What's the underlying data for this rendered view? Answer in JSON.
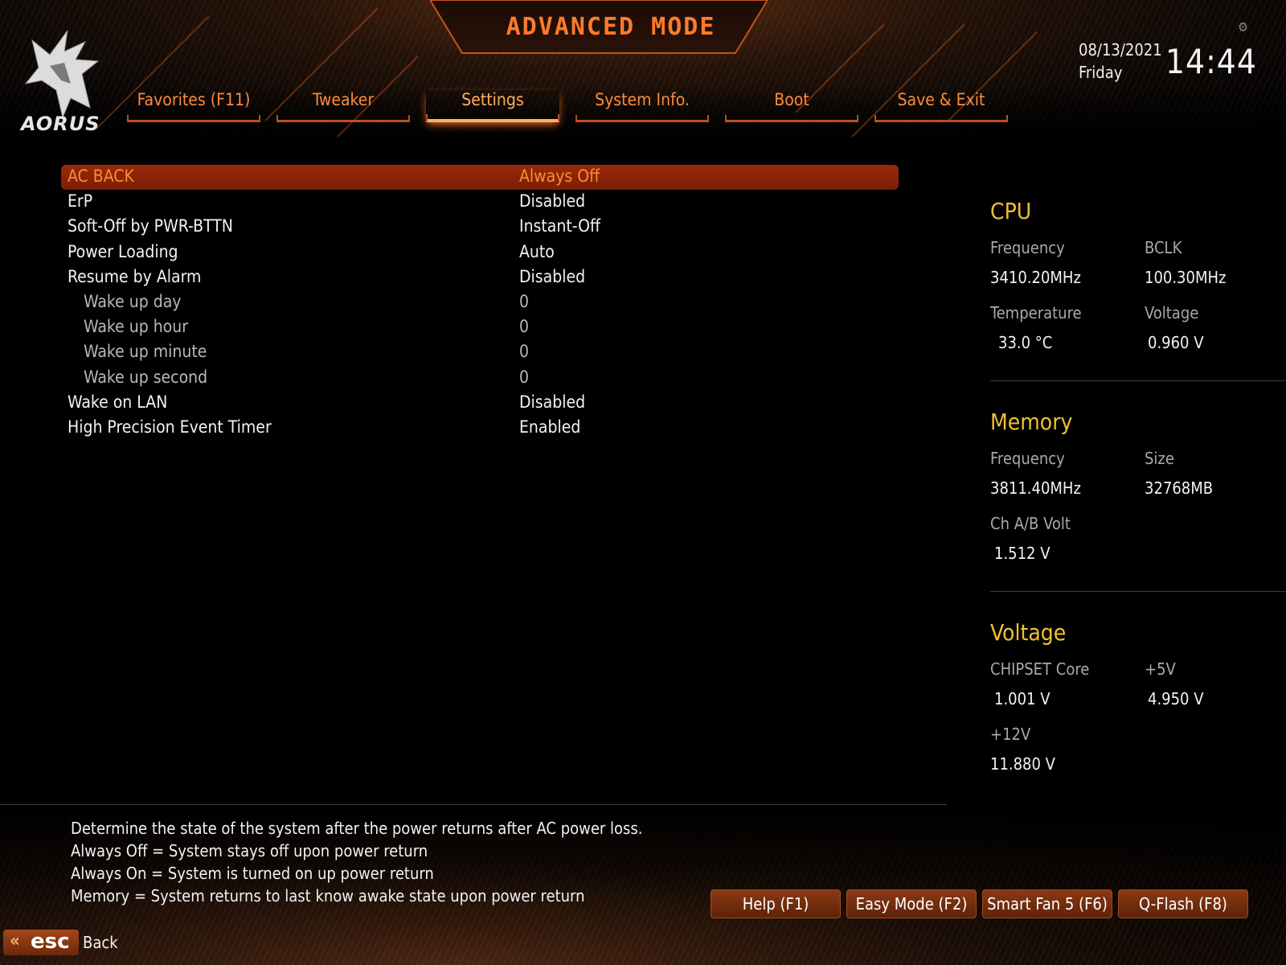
{
  "header": {
    "title": "ADVANCED MODE",
    "brand": "AORUS",
    "date": "08/13/2021",
    "day": "Friday",
    "time": "14:44"
  },
  "tabs": [
    {
      "label": "Favorites (F11)",
      "active": false
    },
    {
      "label": "Tweaker",
      "active": false
    },
    {
      "label": "Settings",
      "active": true
    },
    {
      "label": "System Info.",
      "active": false
    },
    {
      "label": "Boot",
      "active": false
    },
    {
      "label": "Save & Exit",
      "active": false
    }
  ],
  "settings": [
    {
      "label": "AC BACK",
      "value": "Always Off",
      "selected": true
    },
    {
      "label": "ErP",
      "value": "Disabled"
    },
    {
      "label": "Soft-Off by PWR-BTTN",
      "value": "Instant-Off"
    },
    {
      "label": "Power Loading",
      "value": "Auto"
    },
    {
      "label": "Resume by Alarm",
      "value": "Disabled"
    },
    {
      "label": "Wake up day",
      "value": "0",
      "sub": true
    },
    {
      "label": "Wake up hour",
      "value": "0",
      "sub": true
    },
    {
      "label": "Wake up minute",
      "value": "0",
      "sub": true
    },
    {
      "label": "Wake up second",
      "value": "0",
      "sub": true
    },
    {
      "label": "Wake on LAN",
      "value": "Disabled"
    },
    {
      "label": "High Precision Event Timer",
      "value": "Enabled"
    }
  ],
  "info": {
    "cpu": {
      "title": "CPU",
      "frequency_label": "Frequency",
      "frequency": "3410.20MHz",
      "bclk_label": "BCLK",
      "bclk": "100.30MHz",
      "temperature_label": "Temperature",
      "temperature": "33.0 °C",
      "voltage_label": "Voltage",
      "voltage": "0.960 V"
    },
    "memory": {
      "title": "Memory",
      "frequency_label": "Frequency",
      "frequency": "3811.40MHz",
      "size_label": "Size",
      "size": "32768MB",
      "chab_label": "Ch A/B Volt",
      "chab": "1.512 V"
    },
    "voltage": {
      "title": "Voltage",
      "chipset_label": "CHIPSET Core",
      "chipset": "1.001 V",
      "p5v_label": "+5V",
      "p5v": "4.950 V",
      "p12v_label": "+12V",
      "p12v": "11.880 V"
    }
  },
  "help": [
    "Determine the state of  the system after the power returns after AC power loss.",
    "Always Off = System stays off upon power return",
    "Always On = System is turned on up power return",
    "Memory = System returns to last know awake state upon power return"
  ],
  "buttons": {
    "help": "Help (F1)",
    "easy": "Easy Mode (F2)",
    "smartfan": "Smart Fan 5 (F6)",
    "qflash": "Q-Flash (F8)",
    "esc": "esc",
    "back": "Back"
  },
  "colors": {
    "accent": "#ff7a2a",
    "section_title": "#f0c030",
    "selected_row": "#8a2406"
  }
}
